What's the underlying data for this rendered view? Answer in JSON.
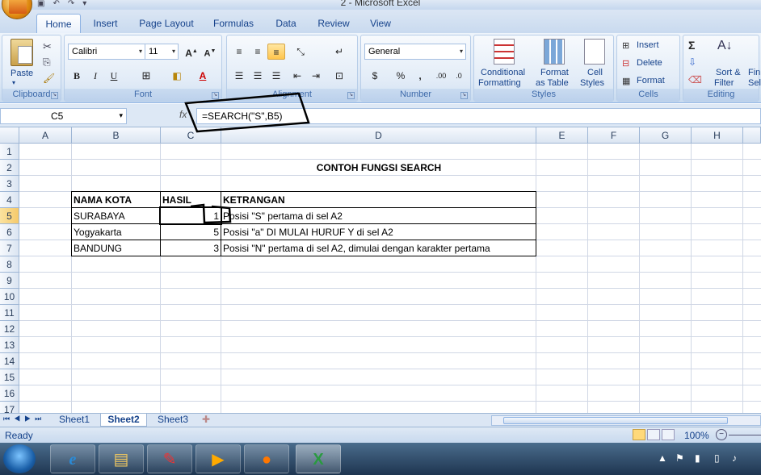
{
  "app": {
    "title": "2 - Microsoft Excel"
  },
  "tabs": [
    "Home",
    "Insert",
    "Page Layout",
    "Formulas",
    "Data",
    "Review",
    "View"
  ],
  "ribbon": {
    "clipboard": {
      "label": "Clipboard",
      "paste": "Paste"
    },
    "font": {
      "label": "Font",
      "name": "Calibri",
      "size": "11",
      "bold": "B",
      "italic": "I",
      "underline": "U"
    },
    "alignment": {
      "label": "Alignment"
    },
    "number": {
      "label": "Number",
      "format": "General",
      "currency": "$",
      "percent": "%",
      "comma": ","
    },
    "styles": {
      "label": "Styles",
      "conditional_1": "Conditional",
      "conditional_2": "Formatting",
      "format_table_1": "Format",
      "format_table_2": "as Table",
      "cell_styles_1": "Cell",
      "cell_styles_2": "Styles"
    },
    "cells": {
      "label": "Cells",
      "insert": "Insert",
      "delete": "Delete",
      "format": "Format"
    },
    "editing": {
      "label": "Editing",
      "sort_1": "Sort &",
      "sort_2": "Filter",
      "find_1": "Fin",
      "find_2": "Sel"
    }
  },
  "formula_bar": {
    "name_box": "C5",
    "fx": "fx",
    "formula": "=SEARCH(\"S\",B5)"
  },
  "grid": {
    "columns": [
      "A",
      "B",
      "C",
      "D",
      "E",
      "F",
      "G",
      "H"
    ],
    "rows": [
      "1",
      "2",
      "3",
      "4",
      "5",
      "6",
      "7",
      "8",
      "9",
      "10",
      "11",
      "12",
      "13",
      "14",
      "15",
      "16",
      "17"
    ],
    "title": "CONTOH FUNGSI SEARCH",
    "headers": {
      "b": "NAMA KOTA",
      "c": "HASIL",
      "d": "KETRANGAN"
    },
    "data": [
      {
        "b": "SURABAYA",
        "c": "1",
        "d": "Posisi \"S\" pertama di sel A2"
      },
      {
        "b": "Yogyakarta",
        "c": "5",
        "d": "Posisi \"a\" DI MULAI HURUF Y di sel A2"
      },
      {
        "b": "BANDUNG",
        "c": "3",
        "d": "Posisi \"N\" pertama di sel A2, dimulai dengan karakter pertama"
      }
    ]
  },
  "sheets": [
    "Sheet1",
    "Sheet2",
    "Sheet3"
  ],
  "status": {
    "ready": "Ready",
    "zoom": "100%"
  },
  "colors": {
    "accent": "#15428b",
    "ribbon": "#dbe7f5"
  }
}
